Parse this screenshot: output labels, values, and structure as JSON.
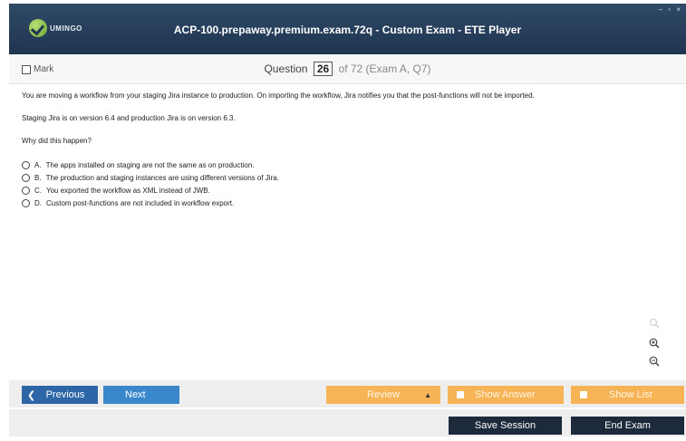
{
  "window": {
    "logo_text": "UMINGO",
    "title": "ACP-100.prepaway.premium.exam.72q - Custom Exam - ETE Player",
    "controls": "– ▫ ×"
  },
  "question_header": {
    "mark_label": "Mark",
    "question_label": "Question",
    "question_number": "26",
    "of_text": "of 72 (Exam A, Q7)"
  },
  "question": {
    "paragraphs": [
      "You are moving a workflow from your staging Jira instance to production. On importing the workflow, Jira notifies you that the post-functions will not be imported.",
      "Staging Jira is on version 6.4 and production Jira is on version 6.3.",
      "Why did this happen?"
    ],
    "options": [
      {
        "letter": "A.",
        "text": "The apps installed on staging are not the same as on production."
      },
      {
        "letter": "B.",
        "text": "The production and staging instances are using different versions of Jira."
      },
      {
        "letter": "C.",
        "text": "You exported the workflow as XML instead of JWB."
      },
      {
        "letter": "D.",
        "text": "Custom post-functions are not included in workflow export."
      }
    ]
  },
  "icons": {
    "search": "search-icon",
    "zoom_in": "zoom-in-icon",
    "zoom_out": "zoom-out-icon"
  },
  "nav": {
    "previous_label": "Previous",
    "next_label": "Next",
    "review_label": "Review",
    "show_answer_label": "Show Answer",
    "show_list_label": "Show List"
  },
  "actions": {
    "save_label": "Save Session",
    "end_label": "End Exam"
  },
  "colors": {
    "titlebar": "#1f3552",
    "previous": "#2c66a6",
    "next": "#3a87cc",
    "orange": "#f6b457",
    "dark_button": "#1c2a3c"
  }
}
